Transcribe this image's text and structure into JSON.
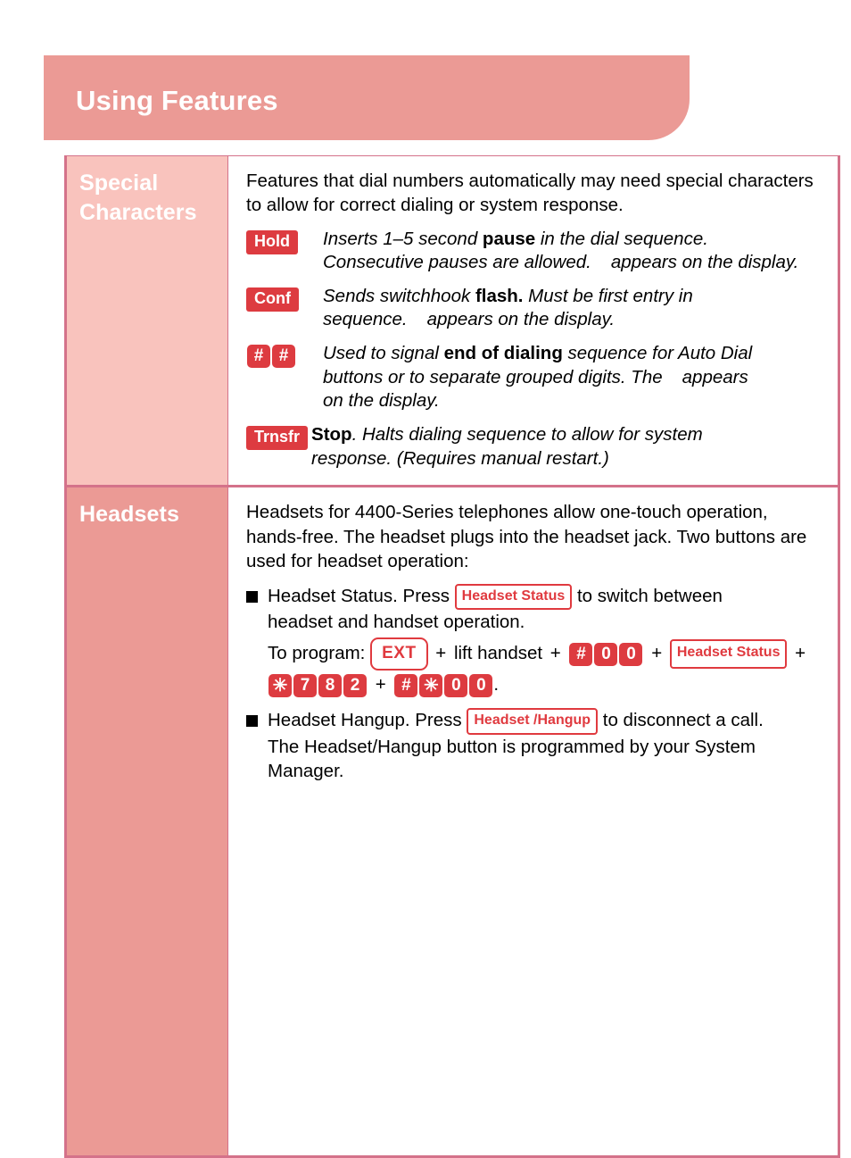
{
  "header": {
    "title": "Using Features"
  },
  "sections": [
    {
      "label": "Special Characters",
      "intro": "Features that dial numbers automatically may need special characters to allow for correct dialing or system response.",
      "definitions": [
        {
          "key": "Hold",
          "key_type": "solid-label",
          "line1_pre": "Inserts 1–5 second ",
          "line1_bold": "pause",
          "line1_post": " in the dial sequence.",
          "line2_pre": "Consecutive pauses are allowed.",
          "line2_post": "appears on the display."
        },
        {
          "key": "Conf",
          "key_type": "solid-label",
          "line1_pre": "Sends switchhook ",
          "line1_bold": "flash.",
          "line1_post": " Must be first entry in",
          "line2_pre": "sequence.",
          "line2_post": "appears on the display."
        },
        {
          "key": "#",
          "key2": "#",
          "key_type": "solid-square-pair",
          "line1_pre": "Used to signal ",
          "line1_bold": "end of dialing",
          "line1_post": " sequence for Auto Dial",
          "line2_pre": "buttons or to separate grouped digits. The",
          "line2_post": "appears",
          "line3": "on the display."
        },
        {
          "key": "Trnsfr",
          "key_type": "solid-label",
          "line1_bold_lead": "Stop",
          "line1_post": ". Halts dialing sequence to allow for system",
          "line2_pre": "response. (Requires manual restart.)"
        }
      ]
    },
    {
      "label": "Headsets",
      "intro": "Headsets for 4400-Series telephones allow one-touch operation, hands-free. The headset plugs into the headset jack. Two buttons are used for headset operation:",
      "bullets": [
        {
          "text_before": "Headset Status. Press",
          "button": "Headset Status",
          "text_after": "to switch between",
          "line2": "headset and handset operation.",
          "program": {
            "prefix": "To program:",
            "ext_button": "EXT",
            "mid_text": "lift handset",
            "keys_row1": [
              "#",
              "0",
              "0"
            ],
            "status_button": "Headset Status",
            "keys_row2a": [
              "✳",
              "7",
              "8",
              "2"
            ],
            "keys_row2b": [
              "#",
              "✳",
              "0",
              "0"
            ],
            "plus": "+",
            "period": "."
          }
        },
        {
          "text_before": "Headset Hangup. Press",
          "button": "Headset /Hangup",
          "text_after": "to disconnect a call.",
          "line2": "The Headset/Hangup button is programmed by your System",
          "line3": "Manager."
        }
      ]
    }
  ],
  "colors": {
    "header_pink": "#eb9a95",
    "light_pink": "#f9c3bd",
    "border_rose": "#d4728a",
    "key_red": "#dd3b40",
    "button_red": "#e03a3f"
  }
}
